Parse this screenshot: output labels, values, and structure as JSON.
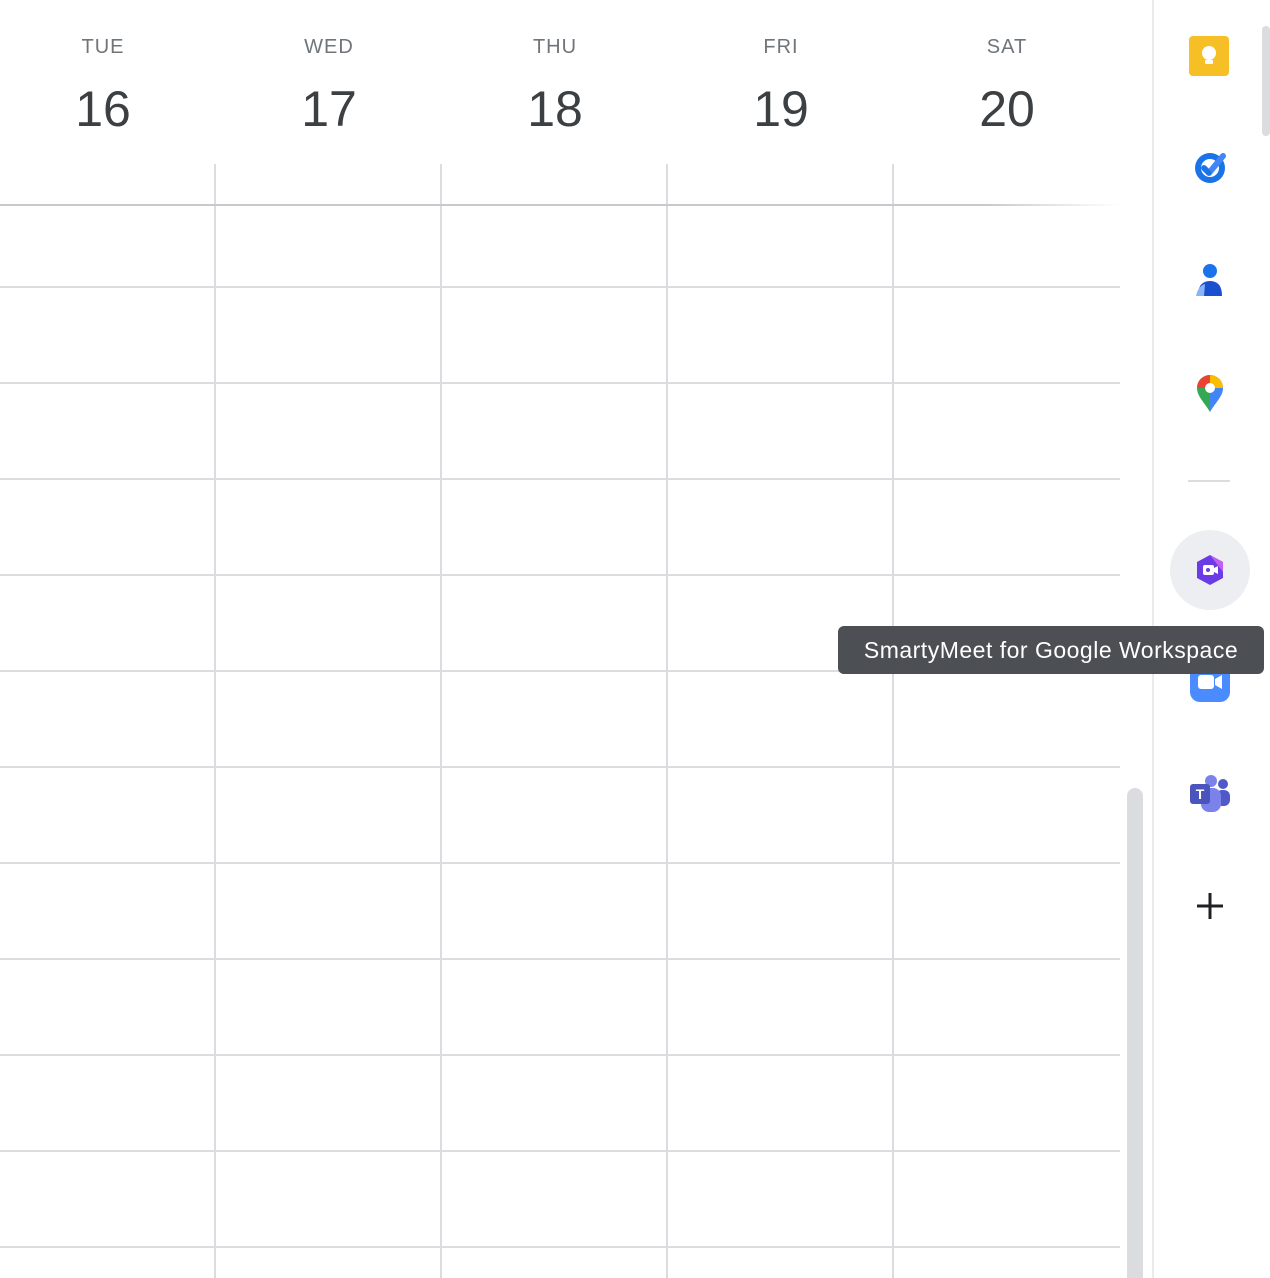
{
  "calendar": {
    "days": [
      {
        "dow": "TUE",
        "num": "16"
      },
      {
        "dow": "WED",
        "num": "17"
      },
      {
        "dow": "THU",
        "num": "18"
      },
      {
        "dow": "FRI",
        "num": "19"
      },
      {
        "dow": "SAT",
        "num": "20"
      }
    ]
  },
  "side_panel": {
    "icons": [
      "keep-icon",
      "tasks-icon",
      "contacts-icon",
      "maps-icon",
      "smartymeet-icon",
      "zoom-icon",
      "teams-icon",
      "add-icon"
    ]
  },
  "tooltip": {
    "text": "SmartyMeet for Google Workspace"
  }
}
